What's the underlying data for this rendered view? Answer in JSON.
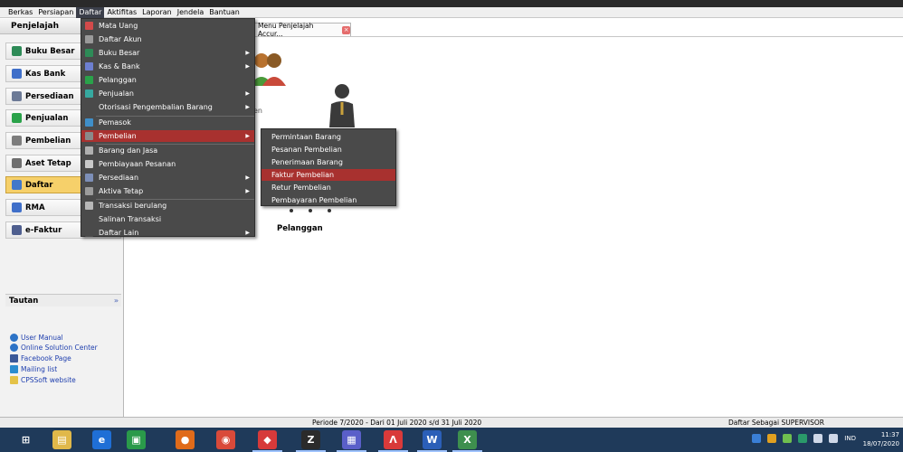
{
  "menubar": {
    "items": [
      "Berkas",
      "Persiapan",
      "Daftar",
      "Aktifitas",
      "Laporan",
      "Jendela",
      "Bantuan"
    ],
    "active": "Daftar"
  },
  "left_panel": {
    "title": "Penjelajah",
    "nav": [
      {
        "label": "Buku Besar",
        "icon": "ledger-icon",
        "color": "#2e8b57"
      },
      {
        "label": "Kas Bank",
        "icon": "cash-bank-icon",
        "color": "#3f6fc9"
      },
      {
        "label": "Persediaan",
        "icon": "inventory-icon",
        "color": "#6c7a96"
      },
      {
        "label": "Penjualan",
        "icon": "sales-icon",
        "color": "#2aa24a"
      },
      {
        "label": "Pembelian",
        "icon": "cart-icon",
        "color": "#7d7d7d"
      },
      {
        "label": "Aset Tetap",
        "icon": "house-icon",
        "color": "#6f6f6f"
      },
      {
        "label": "Daftar",
        "icon": "list-icon",
        "color": "#4278c9"
      },
      {
        "label": "RMA",
        "icon": "rma-icon",
        "color": "#3f6fc9"
      },
      {
        "label": "e-Faktur",
        "icon": "invoice-icon",
        "color": "#4f5f8f"
      }
    ],
    "selected": "Daftar",
    "tautan_title": "Tautan",
    "links": [
      {
        "label": "User Manual",
        "icon": "help-icon"
      },
      {
        "label": "Online Solution Center",
        "icon": "help-icon"
      },
      {
        "label": "Facebook Page",
        "icon": "facebook-icon"
      },
      {
        "label": "Mailing list",
        "icon": "mailing-icon"
      },
      {
        "label": "CPSSoft website",
        "icon": "website-icon"
      }
    ]
  },
  "tab": {
    "label": "Menu Penjelajah Accur...",
    "close": "×"
  },
  "workspace": {
    "pelanggan_label": "Pelanggan",
    "behind_text": "en"
  },
  "dropdown": {
    "items": [
      {
        "label": "Mata Uang",
        "icon": "currency-icon",
        "color": "#d24a4a",
        "submenu": false
      },
      {
        "label": "Daftar Akun",
        "icon": "accounts-icon",
        "color": "#9a9a9a",
        "submenu": false
      },
      {
        "label": "Buku Besar",
        "icon": "ledger-icon",
        "color": "#2e8b57",
        "submenu": true
      },
      {
        "label": "Kas & Bank",
        "icon": "cash-bank-icon",
        "color": "#6d7fd0",
        "submenu": true
      },
      {
        "label": "Pelanggan",
        "icon": "customer-icon",
        "color": "#2aa24a",
        "submenu": false
      },
      {
        "label": "Penjualan",
        "icon": "sales-icon",
        "color": "#36a9a0",
        "submenu": true
      },
      {
        "label": "Otorisasi Pengembalian Barang",
        "icon": "rma-icon",
        "color": "#4a4a4a",
        "submenu": true
      },
      {
        "label": "Pemasok",
        "icon": "supplier-icon",
        "color": "#3f8fc9",
        "submenu": false
      },
      {
        "label": "Pembelian",
        "icon": "cart-icon",
        "color": "#8a8a8a",
        "submenu": true
      },
      {
        "label": "Barang dan Jasa",
        "icon": "goods-icon",
        "color": "#b0b0b0",
        "submenu": false
      },
      {
        "label": "Pembiayaan Pesanan",
        "icon": "financing-icon",
        "color": "#c9c9c9",
        "submenu": false
      },
      {
        "label": "Persediaan",
        "icon": "inventory-icon",
        "color": "#7d8fb8",
        "submenu": true
      },
      {
        "label": "Aktiva Tetap",
        "icon": "house-icon",
        "color": "#9c9c9c",
        "submenu": true
      },
      {
        "label": "Transaksi berulang",
        "icon": "recurring-icon",
        "color": "#b7b7b7",
        "submenu": false
      },
      {
        "label": "Salinan Transaksi",
        "icon": "copy-icon",
        "color": "#4a4a4a",
        "submenu": false
      },
      {
        "label": "Daftar Lain",
        "icon": "other-icon",
        "color": "#4a4a4a",
        "submenu": true
      }
    ],
    "highlighted": "Pembelian"
  },
  "submenu": {
    "items": [
      "Permintaan Barang",
      "Pesanan Pembelian",
      "Penerimaan Barang",
      "Faktur Pembelian",
      "Retur Pembelian",
      "Pembayaran Pembelian"
    ],
    "highlighted": "Faktur Pembelian"
  },
  "status": {
    "period": "Periode 7/2020 - Dari 01 Juli 2020 s/d 31 Juli 2020",
    "user": "Daftar Sebagai SUPERVISOR"
  },
  "taskbar": {
    "apps": [
      {
        "name": "start-icon",
        "glyph": "⊞",
        "color": "#1f3a5a"
      },
      {
        "name": "file-explorer-icon",
        "glyph": "▤",
        "color": "#e0b84a"
      },
      {
        "name": "edge-icon",
        "glyph": "e",
        "color": "#1f6fd6"
      },
      {
        "name": "store-icon",
        "glyph": "▣",
        "color": "#2a9a4a"
      },
      {
        "name": "firefox-icon",
        "glyph": "●",
        "color": "#e06b1a"
      },
      {
        "name": "chrome-icon",
        "glyph": "◉",
        "color": "#d94a3a"
      },
      {
        "name": "app-red-icon",
        "glyph": "◆",
        "color": "#d63a3a"
      },
      {
        "name": "zoom-z-icon",
        "glyph": "Z",
        "color": "#2b2b2b"
      },
      {
        "name": "accurate-icon",
        "glyph": "▦",
        "color": "#5a5fc9"
      },
      {
        "name": "anydesk-icon",
        "glyph": "Λ",
        "color": "#d93a3a"
      },
      {
        "name": "word-icon",
        "glyph": "W",
        "color": "#2b5fb8"
      },
      {
        "name": "excel-icon",
        "glyph": "X",
        "color": "#3e8f4e"
      }
    ],
    "lang": "IND",
    "time": "11:37",
    "date": "18/07/2020"
  }
}
